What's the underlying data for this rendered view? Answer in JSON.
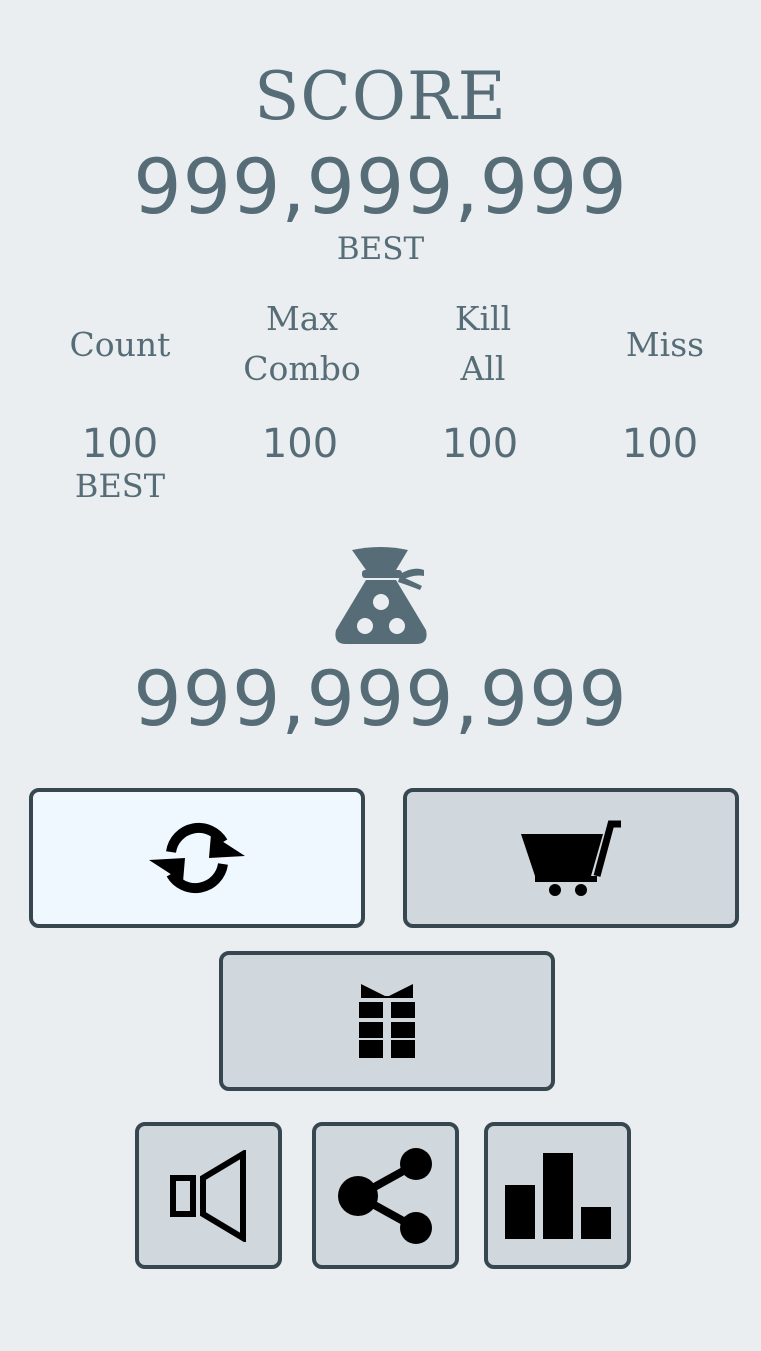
{
  "score": {
    "label": "SCORE",
    "value": "999,999,999",
    "best_label": "BEST"
  },
  "stats": [
    {
      "label_line1": "Count",
      "label_line2": "",
      "value": "100",
      "best_label": "BEST"
    },
    {
      "label_line1": "Max",
      "label_line2": "Combo",
      "value": "100",
      "best_label": ""
    },
    {
      "label_line1": "Kill",
      "label_line2": "All",
      "value": "100",
      "best_label": ""
    },
    {
      "label_line1": "Miss",
      "label_line2": "",
      "value": "100",
      "best_label": ""
    }
  ],
  "coins": {
    "icon": "money-bag-icon",
    "value": "999,999,999"
  },
  "buttons": {
    "replay": {
      "icon": "refresh-icon"
    },
    "shop": {
      "icon": "cart-icon"
    },
    "gift": {
      "icon": "gift-icon"
    },
    "sound": {
      "icon": "speaker-icon"
    },
    "share": {
      "icon": "share-icon"
    },
    "leaderboard": {
      "icon": "bar-chart-icon"
    }
  },
  "colors": {
    "background": "#ebeef0",
    "text": "#566d78",
    "button_fill": "#d0d8dd",
    "button_fill_active": "#f0f8ff",
    "button_border": "#37474f"
  }
}
